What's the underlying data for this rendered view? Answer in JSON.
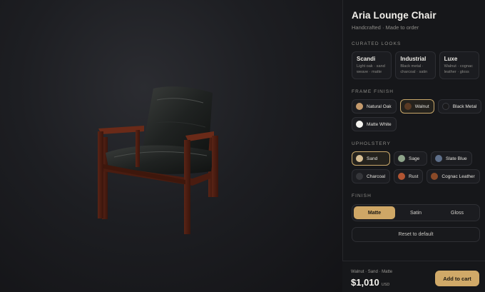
{
  "product": {
    "title": "Aria Lounge Chair",
    "subtitle": "Handcrafted · Made to order"
  },
  "curated_looks": {
    "label": "CURATED LOOKS",
    "items": [
      {
        "name": "Scandi",
        "desc_1": "Light oak · sand",
        "desc_2": "weave · matte"
      },
      {
        "name": "Industrial",
        "desc_1": "Black metal ·",
        "desc_2": "charcoal · satin"
      },
      {
        "name": "Luxe",
        "desc_1": "Walnut · cognac",
        "desc_2": "leather · gloss"
      }
    ]
  },
  "frame_finish": {
    "label": "FRAME FINISH",
    "options": [
      {
        "label": "Natural Oak",
        "color": "#c49a6c"
      },
      {
        "label": "Walnut",
        "color": "#5a3a24"
      },
      {
        "label": "Black Metal",
        "color": "#1a1a1c"
      },
      {
        "label": "Matte White",
        "color": "#f4f3ef"
      }
    ],
    "selected": "Walnut"
  },
  "upholstery": {
    "label": "UPHOLSTERY",
    "options": [
      {
        "label": "Sand",
        "color": "#d8bf94"
      },
      {
        "label": "Sage",
        "color": "#8ea48a"
      },
      {
        "label": "Slate Blue",
        "color": "#5e6f8a"
      },
      {
        "label": "Charcoal",
        "color": "#35363a"
      },
      {
        "label": "Rust",
        "color": "#b25532"
      },
      {
        "label": "Cognac Leather",
        "color": "#8a4a28"
      }
    ],
    "selected": "Sand"
  },
  "finish": {
    "label": "FINISH",
    "options": [
      "Matte",
      "Satin",
      "Gloss"
    ],
    "selected": "Matte"
  },
  "reset_label": "Reset to default",
  "footer": {
    "summary": "Walnut · Sand · Matte",
    "price": "$1,010",
    "currency": "USD",
    "cart_label": "Add to cart"
  },
  "colors": {
    "accent": "#cfa766",
    "panel_bg": "#16171a"
  }
}
